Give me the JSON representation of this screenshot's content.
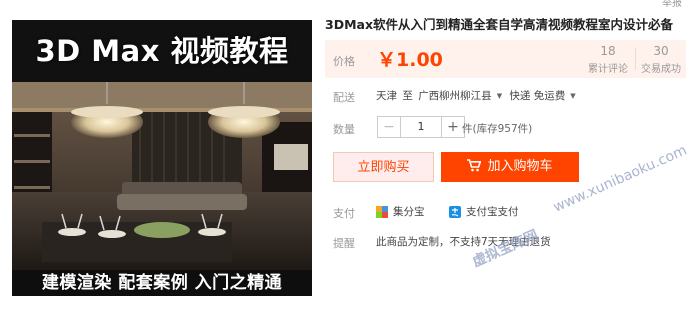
{
  "image": {
    "title": "3D Max 视频教程",
    "bottom_caption": "建模渲染  配套案例  入门之精通"
  },
  "top_corner_text": "举报",
  "product": {
    "title": "3DMax软件从入门到精通全套自学高清视频教程室内设计必备",
    "price_label": "价格",
    "price": "￥1.00",
    "reviews_count": "18",
    "reviews_label": "累计评论",
    "sales_count": "30",
    "sales_label": "交易成功"
  },
  "shipping": {
    "label": "配送",
    "from": "天津",
    "to_word": "至",
    "destination": "广西柳州柳江县",
    "delivery": "快递 免运费"
  },
  "quantity": {
    "label": "数量",
    "minus": "−",
    "value": "1",
    "plus": "+",
    "stock": "件(库存957件)"
  },
  "buttons": {
    "buy_now": "立即购买",
    "add_to_cart": "加入购物车"
  },
  "payment": {
    "label": "支付",
    "method1": "集分宝",
    "method2": "支付宝支付"
  },
  "tips": {
    "label": "提醒",
    "text": "此商品为定制，不支持7天无理由退货"
  },
  "watermarks": {
    "url": "www.xunibaoku.com",
    "site": "虚拟宝库网"
  },
  "colors": {
    "accent": "#ff4400",
    "price_bg": "#fff1ec",
    "buy_now_bg": "#ffeded"
  }
}
